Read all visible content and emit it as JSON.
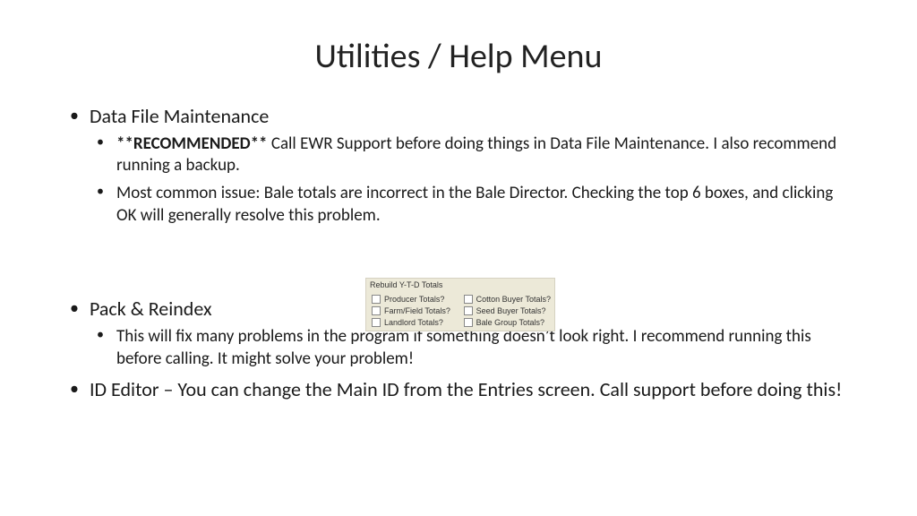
{
  "title": "Utilities / Help Menu",
  "items": {
    "dfm_label": "Data File Maintenance",
    "dfm_sub1_prefix": "**RECOMMENDED** ",
    "dfm_sub1_rest": "Call EWR Support before doing things in Data File Maintenance. I also recommend running a backup.",
    "dfm_sub2": "Most common issue: Bale totals are incorrect in the Bale Director. Checking the top 6 boxes, and clicking OK will generally resolve this problem.",
    "pack_label": "Pack & Reindex",
    "pack_sub1": "This will fix many problems in the program if something doesn’t look right. I recommend running this before calling. It might solve your problem!",
    "ideditor": "ID Editor – You can change the Main ID from the Entries screen. Call support before doing this!"
  },
  "panel": {
    "title": "Rebuild Y-T-D Totals",
    "checks": {
      "c1": "Producer Totals?",
      "c2": "Cotton Buyer Totals?",
      "c3": "Farm/Field Totals?",
      "c4": "Seed Buyer Totals?",
      "c5": "Landlord Totals?",
      "c6": "Bale Group Totals?"
    }
  }
}
